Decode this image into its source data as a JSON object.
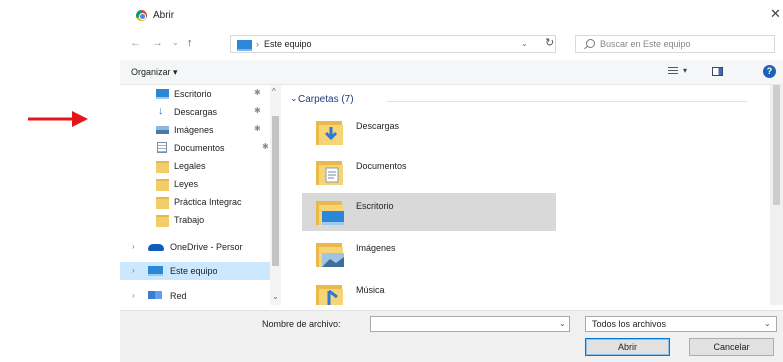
{
  "window": {
    "title": "Abrir",
    "close_glyph": "✕"
  },
  "nav_bar": {
    "back_glyph": "←",
    "forward_glyph": "→",
    "recent_glyph": "⌄",
    "up_glyph": "↑",
    "breadcrumb_sep": "›",
    "address": "Este equipo",
    "address_drop": "⌄",
    "refresh_glyph": "↻",
    "search_placeholder": "Buscar en Este equipo"
  },
  "toolbar": {
    "organize_label": "Organizar ▾",
    "view_drop": "▾",
    "help_glyph": "?"
  },
  "nav_pane": {
    "pin_glyph": "✱",
    "expand_glyph": "›",
    "items": [
      {
        "label": "Escritorio",
        "icon": "desktop-icon"
      },
      {
        "label": "Descargas",
        "icon": "download-icon"
      },
      {
        "label": "Imágenes",
        "icon": "pictures-icon"
      },
      {
        "label": "Documentos",
        "icon": "documents-icon"
      },
      {
        "label": "Legales",
        "icon": "folder-icon"
      },
      {
        "label": "Leyes",
        "icon": "folder-icon"
      },
      {
        "label": "Práctica Integrac",
        "icon": "folder-icon"
      },
      {
        "label": "Trabajo",
        "icon": "folder-icon"
      },
      {
        "label": "OneDrive - Persor",
        "icon": "onedrive-icon"
      },
      {
        "label": "Este equipo",
        "icon": "computer-icon"
      },
      {
        "label": "Red",
        "icon": "network-icon"
      }
    ],
    "scroll_up": "^",
    "scroll_down": "⌄"
  },
  "content": {
    "group_chevron": "⌄",
    "group_title": "Carpetas (7)",
    "folders": [
      {
        "label": "Descargas",
        "icon": "downloads-folder-icon"
      },
      {
        "label": "Documentos",
        "icon": "documents-folder-icon"
      },
      {
        "label": "Escritorio",
        "icon": "desktop-folder-icon",
        "selected": true
      },
      {
        "label": "Imágenes",
        "icon": "pictures-folder-icon"
      },
      {
        "label": "Música",
        "icon": "music-folder-icon"
      }
    ]
  },
  "footer": {
    "filename_label": "Nombre de archivo:",
    "filename_value": "",
    "dropdown_glyph": "⌄",
    "filter_label": "Todos los archivos",
    "open_label": "Abrir",
    "cancel_label": "Cancelar"
  },
  "colors": {
    "annotation_arrow": "#e8141c",
    "selection": "#cce8ff",
    "accent": "#0078d7"
  }
}
